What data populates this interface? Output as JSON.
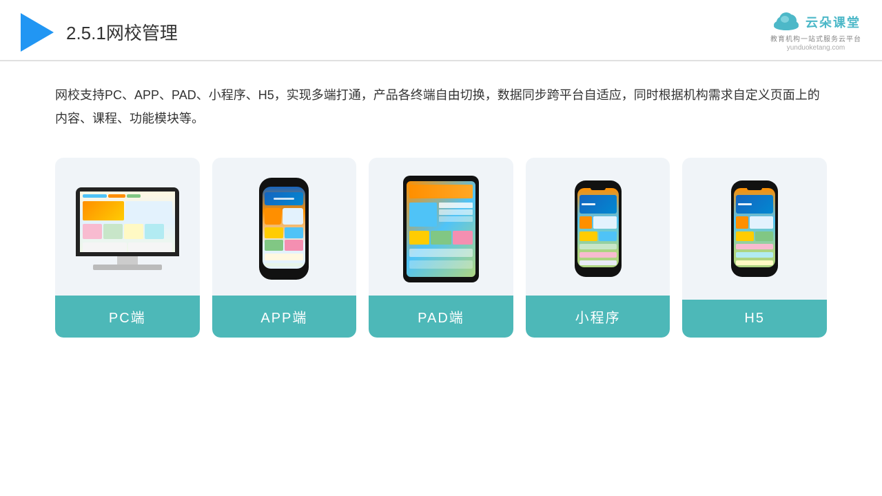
{
  "header": {
    "title_prefix": "2.5.1",
    "title_main": "网校管理",
    "logo_main": "云朵课堂",
    "logo_url": "yunduoketang.com",
    "logo_tagline": "教育机构一站式服务云平台"
  },
  "description": "网校支持PC、APP、PAD、小程序、H5，实现多端打通，产品各终端自由切换，数据同步跨平台自适应，同时根据机构需求自定义页面上的内容、课程、功能模块等。",
  "cards": [
    {
      "id": "pc",
      "label": "PC端"
    },
    {
      "id": "app",
      "label": "APP端"
    },
    {
      "id": "pad",
      "label": "PAD端"
    },
    {
      "id": "miniprogram",
      "label": "小程序"
    },
    {
      "id": "h5",
      "label": "H5"
    }
  ]
}
